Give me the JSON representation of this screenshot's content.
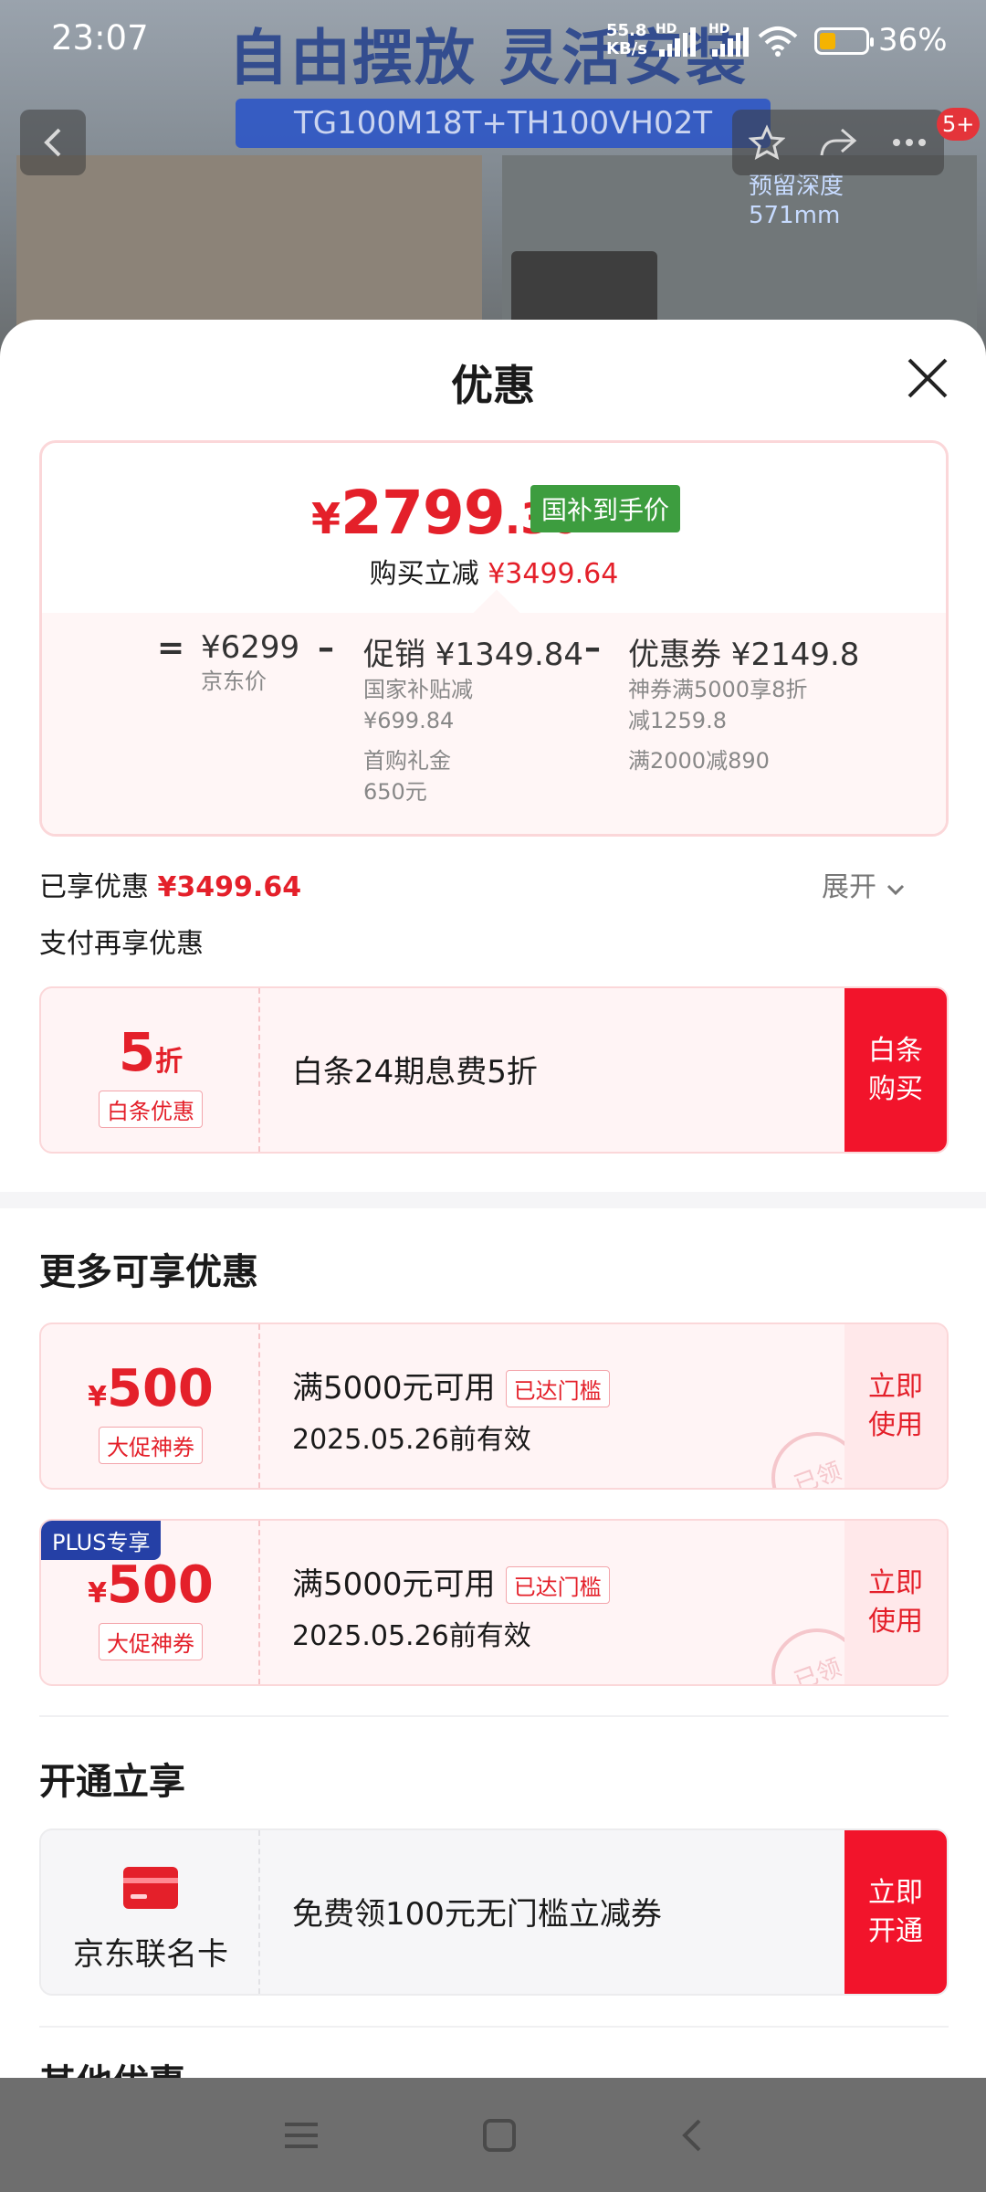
{
  "status_bar": {
    "time": "23:07",
    "net_speed_value": "55.8",
    "net_speed_unit": "KB/s",
    "hd1": "HD",
    "hd2": "HD",
    "wifi_label": "6",
    "battery_percent": "36%",
    "battery_level": 0.36,
    "battery_color": "#f5b301"
  },
  "product_page": {
    "banner_title": "自由摆放 灵活安装",
    "model": "TG100M18T+TH100VH02T",
    "depth_label": "预留深度",
    "depth_value": "571mm",
    "message_badge": "5+",
    "icons": [
      "back-arrow-icon",
      "star-icon",
      "share-icon",
      "more-icon"
    ]
  },
  "sheet": {
    "title": "优惠",
    "close_icon": "close-icon",
    "summary": {
      "price_symbol": "¥",
      "price_integer": "2799",
      "price_decimal": ".36",
      "price_tag": "国补到手价",
      "cut_label": "购买立减",
      "cut_amount": "¥3499.64",
      "eq_sign": "=",
      "base_amount": "¥6299",
      "base_label": "京东价",
      "minus1": "–",
      "promo_title": "促销 ¥1349.84",
      "promo_items": [
        "国家补贴减",
        "¥699.84",
        "首购礼金",
        "650元"
      ],
      "minus2": "–",
      "coupon_title": "优惠券 ¥2149.8",
      "coupon_items": [
        "神券满5000享8折",
        "减1259.8",
        "满2000减890"
      ]
    },
    "enjoyed_label": "已享优惠",
    "enjoyed_amount": "¥3499.64",
    "expand_label": "展开",
    "pay_more_label": "支付再享优惠",
    "baitiao": {
      "discount_value": "5",
      "discount_unit": "折",
      "tag": "白条优惠",
      "description": "白条24期息费5折",
      "button": "白条购买"
    },
    "more_section_title": "更多可享优惠",
    "coupons": [
      {
        "plus_badge": "",
        "currency": "¥",
        "amount": "500",
        "type": "大促神券",
        "condition": "满5000元可用",
        "status_tag": "已达门槛",
        "validity": "2025.05.26前有效",
        "button": "立即使用",
        "stamp": "已领"
      },
      {
        "plus_badge": "PLUS专享",
        "currency": "¥",
        "amount": "500",
        "type": "大促神券",
        "condition": "满5000元可用",
        "status_tag": "已达门槛",
        "validity": "2025.05.26前有效",
        "button": "立即使用",
        "stamp": "已领"
      }
    ],
    "open_section_title": "开通立享",
    "card_offer": {
      "card_icon": "credit-card-icon",
      "card_name": "京东联名卡",
      "description": "免费领100元无门槛立减券",
      "button": "立即开通"
    },
    "next_section_title": "其他优惠"
  },
  "system_nav": {
    "icons": [
      "menu-icon",
      "home-square-icon",
      "back-icon"
    ]
  },
  "colors": {
    "brand_red": "#e4202a",
    "button_red": "#f2142b",
    "green_tag": "#3d9d3f",
    "plus_blue": "#2540a6"
  }
}
